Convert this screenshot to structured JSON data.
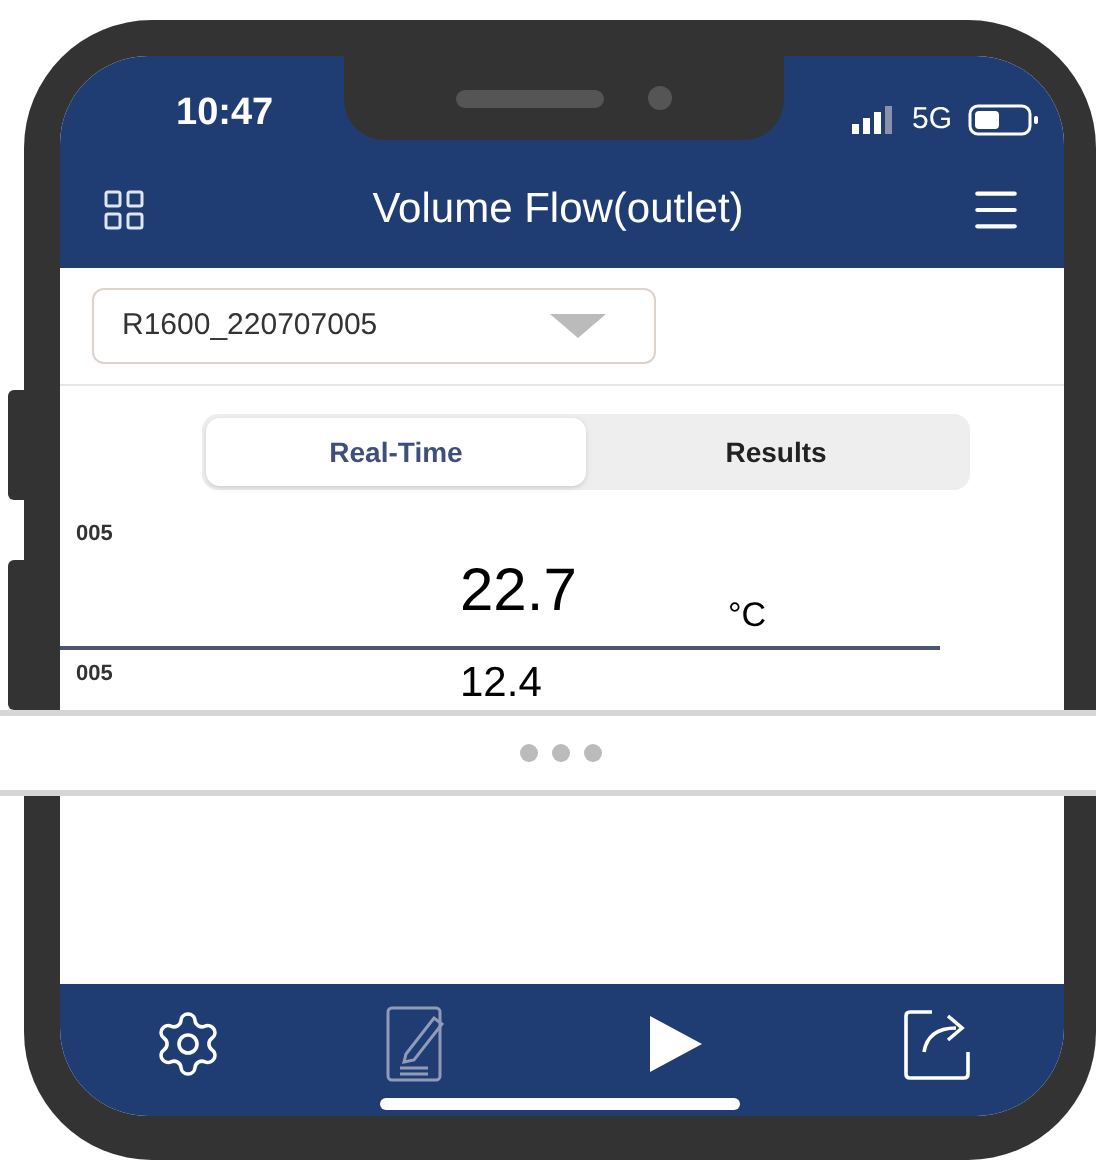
{
  "status_bar": {
    "time": "10:47",
    "network": "5G"
  },
  "header": {
    "title": "Volume Flow(outlet)"
  },
  "device_select": {
    "value": "R1600_220707005"
  },
  "tabs": [
    {
      "label": "Real-Time",
      "selected": true
    },
    {
      "label": "Results",
      "selected": false
    }
  ],
  "readings": [
    {
      "channel": "005",
      "value": "22.7",
      "unit": "°C"
    },
    {
      "channel": "005",
      "value": "12.4"
    }
  ]
}
